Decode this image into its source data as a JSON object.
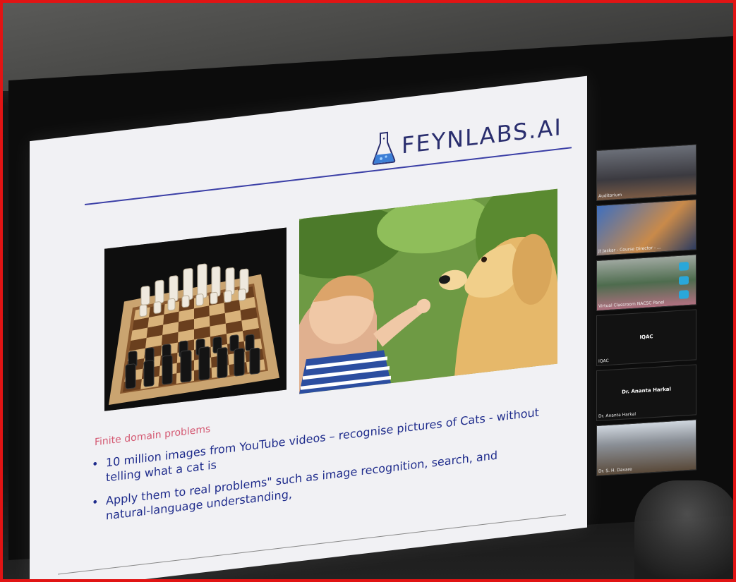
{
  "slide": {
    "logo_text": "FEYNLABS.AI",
    "section_title": "Finite domain problems",
    "bullets": [
      "10 million images from YouTube videos – recognise pictures of Cats - without telling what a cat is",
      "Apply them to real problems\" such as image recognition, search, and natural-language understanding,"
    ]
  },
  "participants": [
    {
      "label": "Auditorium"
    },
    {
      "label": "Jt Jaskar - Course Director - ..."
    },
    {
      "label": "Virtual Classroom NACSC Panel"
    },
    {
      "label": "IQAC",
      "name": "IQAC"
    },
    {
      "label": "Dr. Ananta Harkal",
      "name": "Dr. Ananta Harkal"
    },
    {
      "label": "Dr. S. H. Davare"
    }
  ],
  "colors": {
    "frame_border": "#e11414",
    "logo": "#2a2e6e",
    "bullet_text": "#1f2c8c",
    "section_title": "#d45a73",
    "panel_icon": "#2aa7d9"
  }
}
